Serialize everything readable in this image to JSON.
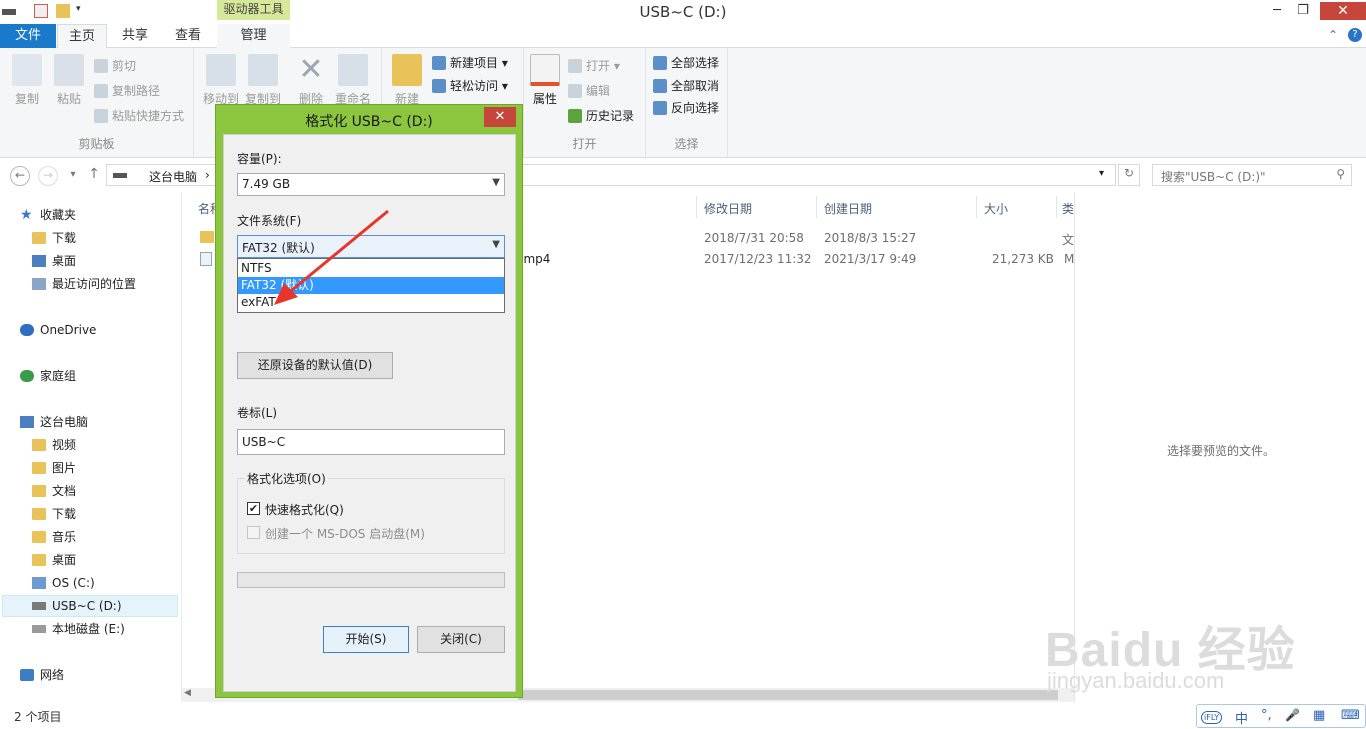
{
  "window": {
    "title": "USB~C (D:)",
    "context_tab_header": "驱动器工具",
    "minimize": "─",
    "maximize": "❐",
    "close": "✕"
  },
  "tabs": {
    "file": "文件",
    "home": "主页",
    "share": "共享",
    "view": "查看",
    "manage": "管理"
  },
  "ribbon": {
    "clipboard": {
      "label": "剪贴板",
      "copy": "复制",
      "paste": "粘贴",
      "cut": "剪切",
      "copy_path": "复制路径",
      "paste_shortcut": "粘贴快捷方式"
    },
    "organize": {
      "move_to": "移动到",
      "copy_to": "复制到",
      "delete": "删除",
      "rename": "重命名"
    },
    "new": {
      "new_folder": "新建",
      "new_item": "新建项目 ▾",
      "easy_access": "轻松访问 ▾"
    },
    "open": {
      "label": "打开",
      "properties": "属性",
      "open": "打开 ▾",
      "edit": "编辑",
      "history": "历史记录"
    },
    "select": {
      "label": "选择",
      "select_all": "全部选择",
      "select_none": "全部取消",
      "invert": "反向选择"
    }
  },
  "address": {
    "back": "←",
    "forward": "→",
    "recent": "▾",
    "up": "↑",
    "path": "这台电脑",
    "path_sep": "›",
    "refresh": "↻",
    "dropdown": "▾",
    "search_placeholder": "搜索\"USB~C (D:)\"",
    "search_icon": "⚲"
  },
  "nav": {
    "favorites": "收藏夹",
    "downloads": "下载",
    "desktop": "桌面",
    "recent": "最近访问的位置",
    "onedrive": "OneDrive",
    "homegroup": "家庭组",
    "this_pc": "这台电脑",
    "videos": "视频",
    "pictures": "图片",
    "documents": "文档",
    "downloads2": "下载",
    "music": "音乐",
    "desktop2": "桌面",
    "os_c": "OS (C:)",
    "usb_d": "USB~C (D:)",
    "local_e": "本地磁盘 (E:)",
    "network": "网络"
  },
  "filelist": {
    "columns": [
      "名称",
      "修改日期",
      "创建日期",
      "大小",
      "类"
    ],
    "rows": [
      {
        "name": "",
        "modified": "2018/7/31 20:58",
        "created": "2018/8/3 15:27",
        "size": "",
        "type": "文"
      },
      {
        "name": "2.mp4",
        "modified": "2017/12/23 11:32",
        "created": "2021/3/17 9:49",
        "size": "21,273 KB",
        "type": "M"
      }
    ]
  },
  "preview": {
    "text": "选择要预览的文件。"
  },
  "status": {
    "items": "2 个项目"
  },
  "ime": {
    "brand": "iFLY",
    "lang": "中",
    "punct": "°,",
    "mic": "🎤",
    "grid": "▦",
    "kbd": "⌨"
  },
  "watermark": {
    "logo": "Baidu 经验",
    "url": "jingyan.baidu.com"
  },
  "dialog": {
    "title": "格式化 USB~C (D:)",
    "close": "✕",
    "capacity_label": "容量(P):",
    "capacity_value": "7.49 GB",
    "fs_label": "文件系统(F)",
    "fs_value": "FAT32 (默认)",
    "fs_options": [
      "NTFS",
      "FAT32 (默认)",
      "exFAT"
    ],
    "fs_selected_index": 1,
    "restore_defaults": "还原设备的默认值(D)",
    "volume_label": "卷标(L)",
    "volume_value": "USB~C",
    "options_legend": "格式化选项(O)",
    "quick_format": "快速格式化(Q)",
    "quick_format_checked": true,
    "msdos_boot": "创建一个 MS-DOS 启动盘(M)",
    "msdos_checked": false,
    "progress": 0,
    "start": "开始(S)",
    "close_btn": "关闭(C)"
  },
  "colors": {
    "dialog_frame": "#8cc63f",
    "accent": "#1979ca",
    "selection": "#3399ff",
    "close_red": "#c7463b",
    "annotation_arrow": "#e8352c"
  }
}
